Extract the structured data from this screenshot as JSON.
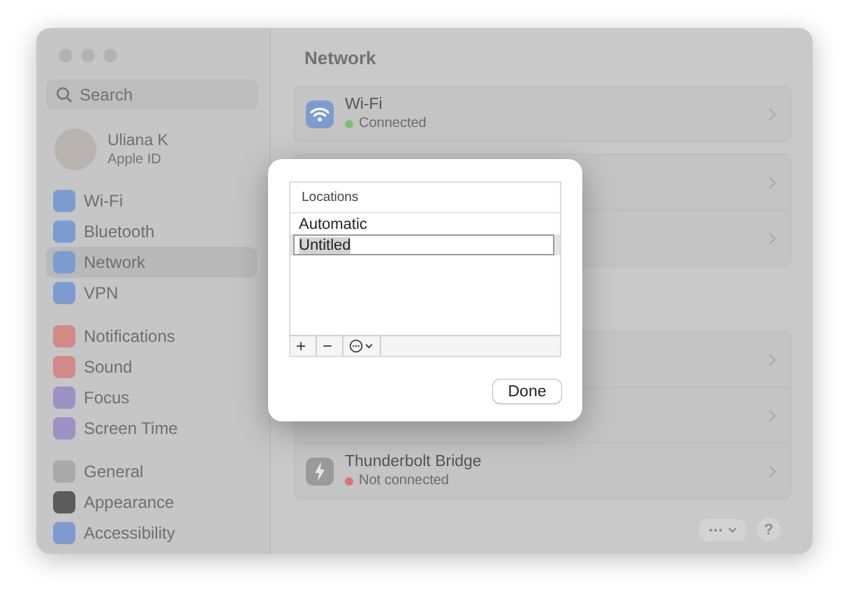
{
  "sidebar": {
    "search": {
      "placeholder": "Search"
    },
    "account": {
      "name": "Uliana K",
      "subtitle": "Apple ID"
    },
    "groups": [
      {
        "items": [
          {
            "label": "Wi-Fi",
            "color": "#7d9bd0",
            "selected": false
          },
          {
            "label": "Bluetooth",
            "color": "#7d9bd0",
            "selected": false
          },
          {
            "label": "Network",
            "color": "#7d9bd0",
            "selected": true
          },
          {
            "label": "VPN",
            "color": "#7d9bd0",
            "selected": false
          }
        ]
      },
      {
        "items": [
          {
            "label": "Notifications",
            "color": "#d28a86",
            "selected": false
          },
          {
            "label": "Sound",
            "color": "#d28a86",
            "selected": false
          },
          {
            "label": "Focus",
            "color": "#9c92c4",
            "selected": false
          },
          {
            "label": "Screen Time",
            "color": "#9c92c4",
            "selected": false
          }
        ]
      },
      {
        "items": [
          {
            "label": "General",
            "color": "#a9a9a9",
            "selected": false
          },
          {
            "label": "Appearance",
            "color": "#5c5c5c",
            "selected": false
          },
          {
            "label": "Accessibility",
            "color": "#7d9bd0",
            "selected": false
          }
        ]
      }
    ]
  },
  "main": {
    "title": "Network",
    "sections": [
      {
        "rows": [
          {
            "kind": "wifi",
            "title": "Wi-Fi",
            "status": "Connected",
            "color": "#78c078"
          }
        ]
      },
      {
        "rows": [
          {
            "kind": "covered"
          },
          {
            "kind": "covered"
          }
        ]
      },
      {
        "rows": [
          {
            "kind": "covered"
          },
          {
            "kind": "covered"
          },
          {
            "kind": "bridge",
            "title": "Thunderbolt Bridge",
            "status": "Not connected",
            "color": "#e0736d"
          }
        ]
      }
    ],
    "help": "?"
  },
  "dialog": {
    "header": "Locations",
    "rows": [
      {
        "label": "Automatic",
        "selected": false,
        "editing": false
      },
      {
        "label": "Untitled",
        "selected": true,
        "editing": true
      }
    ],
    "toolbar": [
      {
        "kind": "text",
        "label": "+"
      },
      {
        "kind": "text",
        "label": "−"
      },
      {
        "kind": "menu"
      }
    ],
    "done": "Done"
  }
}
